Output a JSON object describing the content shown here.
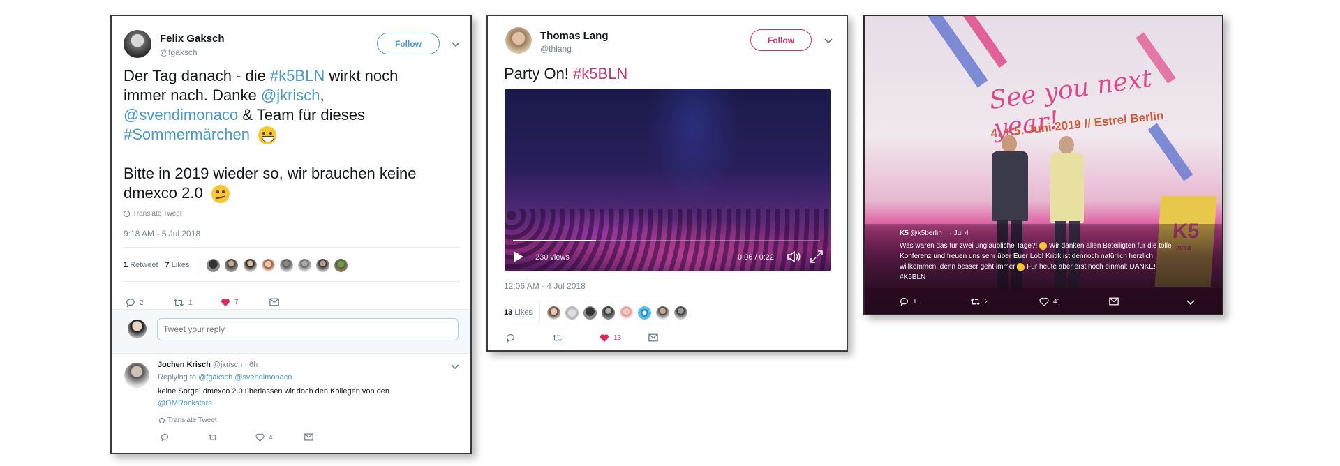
{
  "tweet1": {
    "name": "Felix Gaksch",
    "handle": "@fgaksch",
    "follow": "Follow",
    "body": {
      "l1a": "Der Tag danach - die ",
      "l1b": "#k5BLN",
      "l1c": " wirkt noch",
      "l2a": "immer nach. Danke ",
      "l2b": "@jkrisch",
      "l2c": ",",
      "l3a": "@svendimonaco",
      "l3b": " & Team für dieses",
      "l4a": "#Sommermärchen",
      "l5": "Bitte in 2019 wieder so, wir brauchen keine",
      "l6": "dmexco 2.0"
    },
    "translate": "Translate Tweet",
    "timestamp": "9:18 AM - 5 Jul 2018",
    "retweets_count": "1",
    "retweets_label": "Retweet",
    "likes_count": "7",
    "likes_label": "Likes",
    "actions": {
      "reply": "2",
      "retweet": "1",
      "like": "7"
    },
    "reply_placeholder": "Tweet your reply",
    "reply": {
      "name": "Jochen Krisch",
      "meta": "@jkrisch · 6h",
      "replying_label": "Replying to",
      "replying_to": "@fgaksch @svendimonaco",
      "text1": "keine Sorge! dmexco 2.0 überlassen wir doch den Kollegen von den",
      "text2": "@OMRockstars",
      "translate": "Translate Tweet",
      "actions": {
        "like": "4"
      }
    }
  },
  "tweet2": {
    "name": "Thomas Lang",
    "handle": "@thlang",
    "follow": "Follow",
    "text_a": "Party On! ",
    "text_b": "#k5BLN",
    "video": {
      "views": "230 views",
      "time": "0:06 / 0:22",
      "progress": 0.27
    },
    "timestamp": "12:06 AM - 4 Jul 2018",
    "likes_count": "13",
    "likes_label": "Likes",
    "actions": {
      "like": "13"
    }
  },
  "tweet3": {
    "stage": {
      "line1": "See you next year!",
      "line2": "4. + 5. Juni 2019 // Estrel Berlin",
      "podium_logo": "K5",
      "podium_year": "2018"
    },
    "name": "K5",
    "handle": "@k5berlin",
    "date": "· Jul 4",
    "text1": "Was waren das für zwei unglaubliche Tage?!",
    "text1b": " Wir danken allen Beteiligten für die tolle",
    "text2": "Konferenz und freuen uns sehr über Euer Lob! Kritik ist dennoch natürlich herzlich",
    "text3": "willkommen, denn besser geht immer",
    "text3b": " Für heute aber erst noch einmal: DANKE!",
    "text4": "#K5BLN",
    "actions": {
      "reply": "1",
      "retweet": "2",
      "like": "41"
    }
  },
  "colors": {
    "link": "#4a99c8",
    "pink": "#c3396f",
    "like": "#e0245e"
  }
}
